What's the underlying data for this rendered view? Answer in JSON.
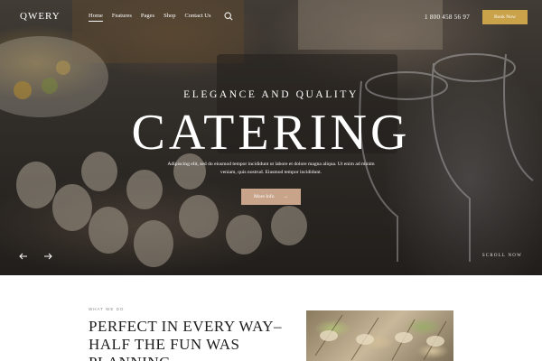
{
  "brand": {
    "logo": "QWERY"
  },
  "nav": {
    "items": [
      "Home",
      "Features",
      "Pages",
      "Shop",
      "Contact Us"
    ],
    "active": "Home",
    "phone": "1 800 458 56 97",
    "book_label": "Book Now"
  },
  "hero": {
    "tagline": "ELEGANCE AND QUALITY",
    "title": "CATERING",
    "description": "Adipiscing elit, sed do eiusmod tempor incididunt ut labore et dolore magna aliqua. Ut enim ad minim veniam, quis nostrud. Eiusmod tempor incididunt.",
    "button_label": "More Info",
    "button_arrow": "→",
    "scroll_label": "SCROLL NOW"
  },
  "section": {
    "label": "WHAT WE DO",
    "title": "PERFECT IN EVERY WAY–HALF THE FUN WAS PLANNING"
  },
  "colors": {
    "accent": "#c9a24a",
    "button_muted": "#c8a48a",
    "text_dark": "#1d1d1d"
  },
  "icons": {
    "search": "search-icon",
    "prev": "arrow-left-icon",
    "next": "arrow-right-icon"
  }
}
